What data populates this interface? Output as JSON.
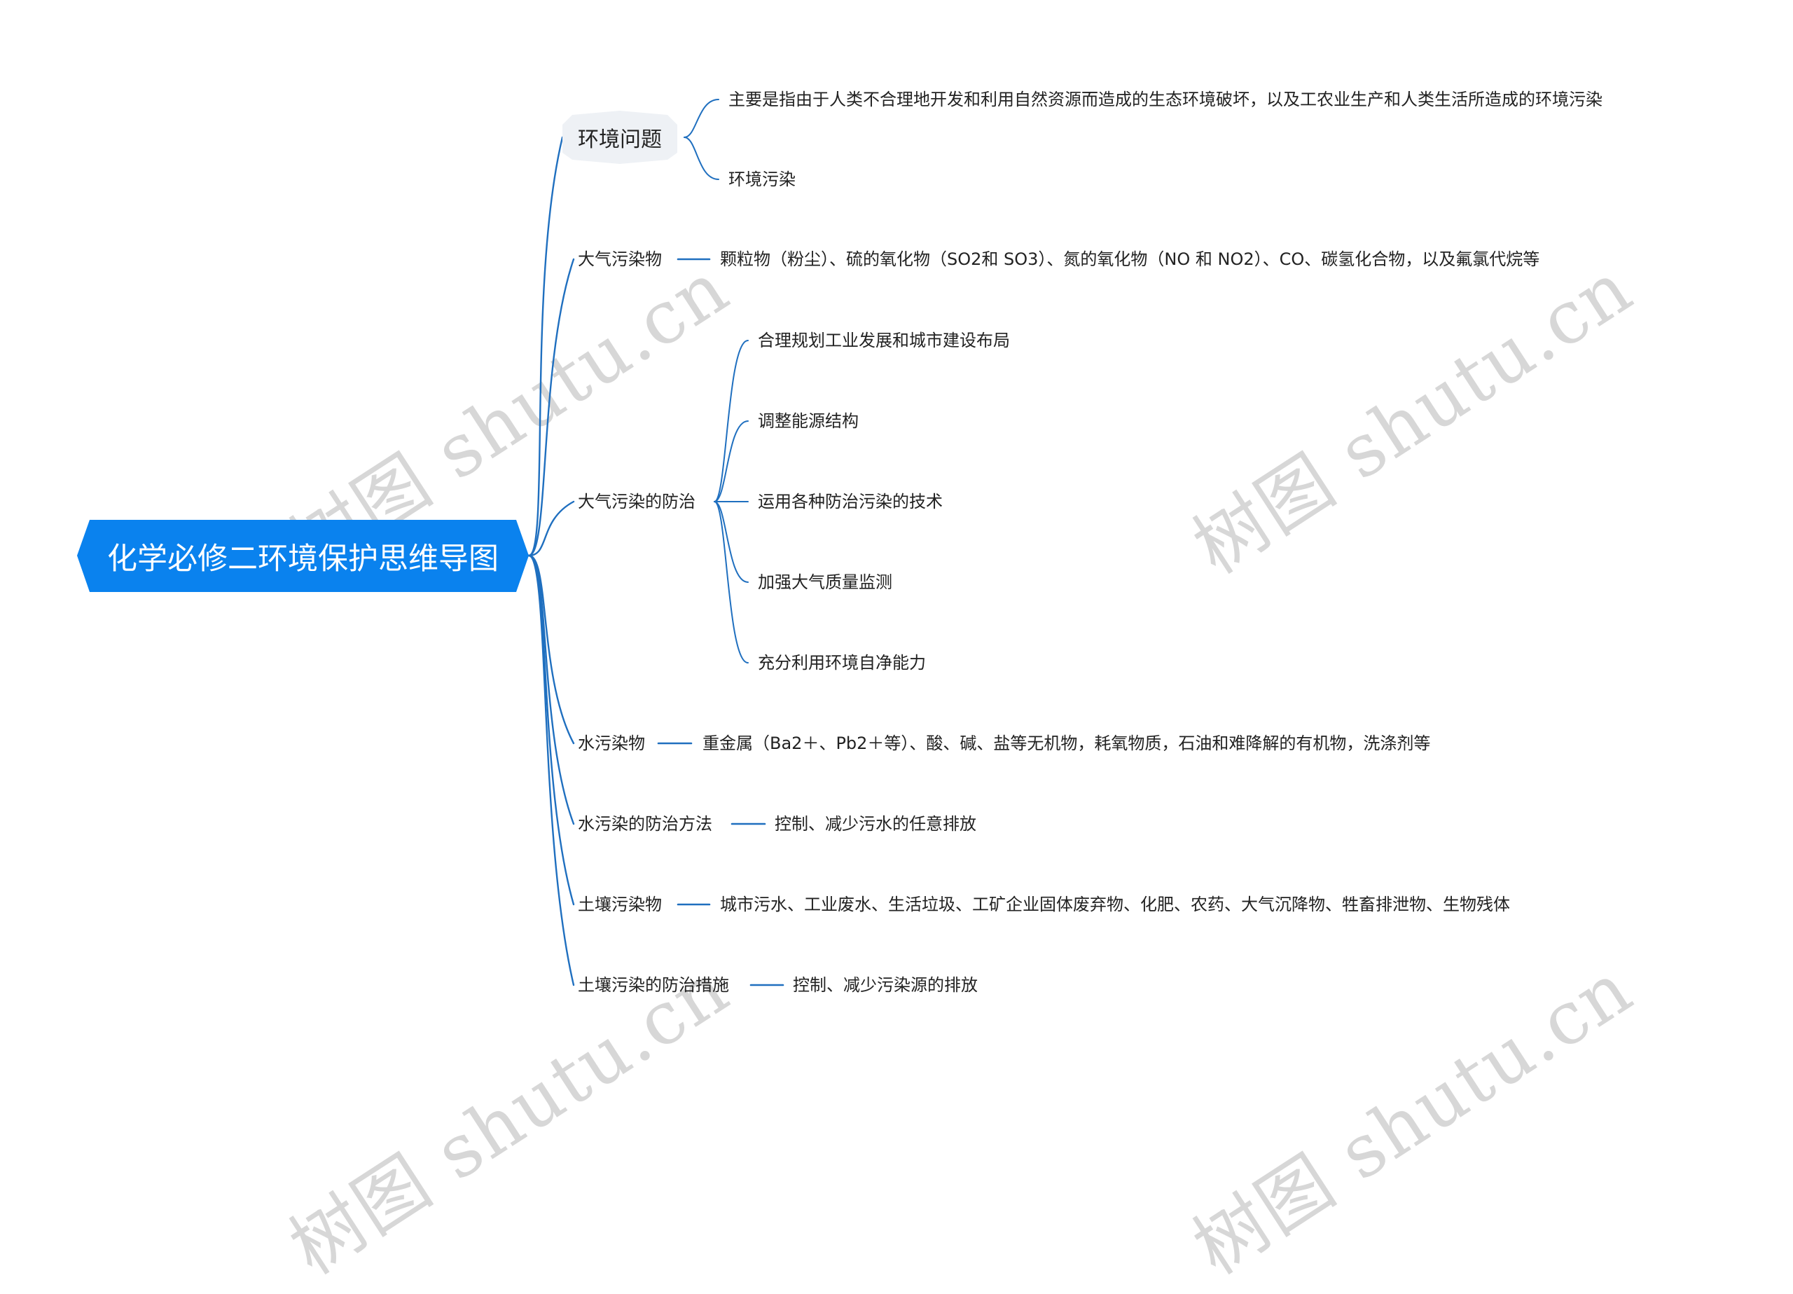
{
  "root": {
    "title": "化学必修二环境保护思维导图"
  },
  "colors": {
    "root_fill": "#0a82ee",
    "connector": "#1f6fbf",
    "topic_fill": "#eef1f5",
    "text": "#222222"
  },
  "watermark": {
    "text": "树图 shutu.cn"
  },
  "branches": [
    {
      "label": "环境问题",
      "children": [
        "主要是指由于人类不合理地开发和利用自然资源而造成的生态环境破坏，以及工农业生产和人类生活所造成的环境污染",
        "环境污染"
      ]
    },
    {
      "label": "大气污染物",
      "children": [
        "颗粒物（粉尘）、硫的氧化物（SO2和 SO3）、氮的氧化物（NO 和 NO2）、CO、碳氢化合物，以及氟氯代烷等"
      ]
    },
    {
      "label": "大气污染的防治",
      "children": [
        "合理规划工业发展和城市建设布局",
        "调整能源结构",
        "运用各种防治污染的技术",
        "加强大气质量监测",
        "充分利用环境自净能力"
      ]
    },
    {
      "label": "水污染物",
      "children": [
        "重金属（Ba2＋、Pb2＋等）、酸、碱、盐等无机物，耗氧物质，石油和难降解的有机物，洗涤剂等"
      ]
    },
    {
      "label": "水污染的防治方法",
      "children": [
        "控制、减少污水的任意排放"
      ]
    },
    {
      "label": "土壤污染物",
      "children": [
        "城市污水、工业废水、生活垃圾、工矿企业固体废弃物、化肥、农药、大气沉降物、牲畜排泄物、生物残体"
      ]
    },
    {
      "label": "土壤污染的防治措施",
      "children": [
        "控制、减少污染源的排放"
      ]
    }
  ]
}
